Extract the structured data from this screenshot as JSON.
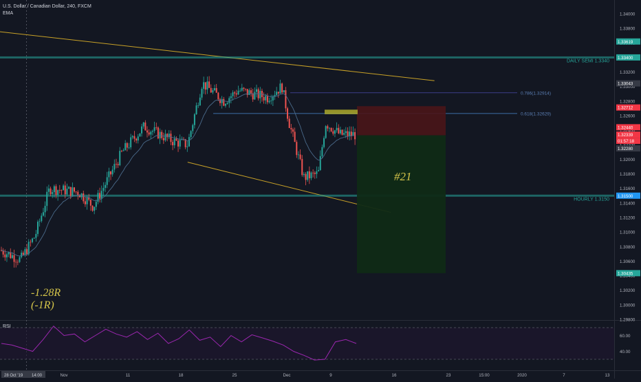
{
  "header": {
    "symbol_title": "U.S. Dollar / Canadian Dollar, 240, FXCM",
    "indicator_label": "EMA"
  },
  "rsi_panel": {
    "label": "RSI",
    "ticks": [
      "60.00",
      "40.00"
    ]
  },
  "chart_data": [
    {
      "type": "candlestick",
      "title": "U.S. Dollar / Canadian Dollar, 240, FXCM",
      "interval": "240",
      "y_axis": {
        "position": "right",
        "range": [
          1.2986,
          1.3429
        ],
        "ticks": [
          "1.34000",
          "1.33800",
          "1.33600",
          "1.33400",
          "1.33200",
          "1.33000",
          "1.32800",
          "1.32600",
          "1.32400",
          "1.32200",
          "1.32000",
          "1.31800",
          "1.31600",
          "1.31400",
          "1.31200",
          "1.31000",
          "1.30800",
          "1.30600",
          "1.30400",
          "1.30200",
          "1.30000",
          "1.29800"
        ]
      },
      "x_axis": {
        "ticks": [
          "Nov",
          "11",
          "18",
          "25",
          "Dec",
          "9",
          "16",
          "23",
          "15:00",
          "2020",
          "7",
          "13"
        ],
        "crosshair_labels": [
          "28 Oct '19",
          "14:00"
        ]
      },
      "price_labels": [
        {
          "text": "1.33619",
          "value": 1.33619,
          "color": "#26a69a"
        },
        {
          "text": "1.33400",
          "value": 1.334,
          "color": "#26a69a"
        },
        {
          "text": "1.33043",
          "value": 1.33043,
          "color": "#363a45"
        },
        {
          "text": "1.32712",
          "value": 1.32712,
          "color": "#f23645"
        },
        {
          "text": "1.32440",
          "value": 1.3244,
          "color": "#f23645"
        },
        {
          "text": "1.32339",
          "value": 1.32339,
          "color": "#f23645"
        },
        {
          "text": "01:57:18",
          "value": 1.32254,
          "color": "#f23645"
        },
        {
          "text": "1.32280",
          "value": 1.3215,
          "color": "#363a45"
        },
        {
          "text": "1.31500",
          "value": 1.315,
          "color": "#2196f3"
        },
        {
          "text": "1.30435",
          "value": 1.30435,
          "color": "#26a69a"
        }
      ],
      "horizontal_levels": [
        {
          "label": "DAILY SEMI 1.3340",
          "value": 1.334,
          "color": "#26a69a"
        },
        {
          "label": "HOURLY 1.3150",
          "value": 1.315,
          "color": "#26a69a"
        }
      ],
      "fib_levels": [
        {
          "label": "0.786(1.32914)",
          "value": 1.32914
        },
        {
          "label": "0.618(1.32629)",
          "value": 1.32629
        }
      ],
      "annotations": [
        "-1.28R",
        "(-1R)",
        "#21"
      ],
      "trade_box": {
        "entry": 1.3233,
        "stop": 1.3273,
        "target": 1.30435,
        "entry_zone_top": 1.32682,
        "entry_zone_bottom": 1.3262
      },
      "trendlines": [
        {
          "from": [
            "Oct 21",
            1.338
          ],
          "to": [
            "Dec 24",
            1.3308
          ]
        },
        {
          "from": [
            "Nov 20",
            1.3196
          ],
          "to": [
            "Dec 18",
            1.3127
          ]
        }
      ],
      "candles_note": "~4h candles from late Oct 2019 to mid Dec 2019; series below approximates closes read from the chart",
      "closes_key_points": [
        [
          "Oct 22",
          1.309
        ],
        [
          "Oct 28",
          1.3062
        ],
        [
          "Oct 30",
          1.3095
        ],
        [
          "Nov 1",
          1.316
        ],
        [
          "Nov 5",
          1.3155
        ],
        [
          "Nov 7",
          1.3135
        ],
        [
          "Nov 11",
          1.321
        ],
        [
          "Nov 14",
          1.3245
        ],
        [
          "Nov 18",
          1.3225
        ],
        [
          "Nov 20",
          1.322
        ],
        [
          "Nov 22",
          1.3305
        ],
        [
          "Nov 25",
          1.328
        ],
        [
          "Nov 27",
          1.3295
        ],
        [
          "Dec 1",
          1.3285
        ],
        [
          "Dec 3",
          1.33
        ],
        [
          "Dec 4",
          1.325
        ],
        [
          "Dec 6",
          1.3175
        ],
        [
          "Dec 8",
          1.318
        ],
        [
          "Dec 9",
          1.325
        ],
        [
          "Dec 11",
          1.3234
        ]
      ]
    },
    {
      "type": "line",
      "title": "RSI",
      "y_axis": {
        "ticks": [
          "60.00",
          "40.00"
        ],
        "upper_band": 70,
        "lower_band": 30
      },
      "series": [
        {
          "name": "RSI",
          "color": "#9c27b0",
          "values": [
            50,
            48,
            44,
            40,
            55,
            72,
            60,
            62,
            52,
            60,
            68,
            62,
            58,
            65,
            55,
            63,
            50,
            56,
            67,
            54,
            58,
            46,
            60,
            52,
            61,
            57,
            53,
            48,
            40,
            35,
            29,
            30,
            52,
            55,
            50
          ]
        }
      ]
    }
  ]
}
